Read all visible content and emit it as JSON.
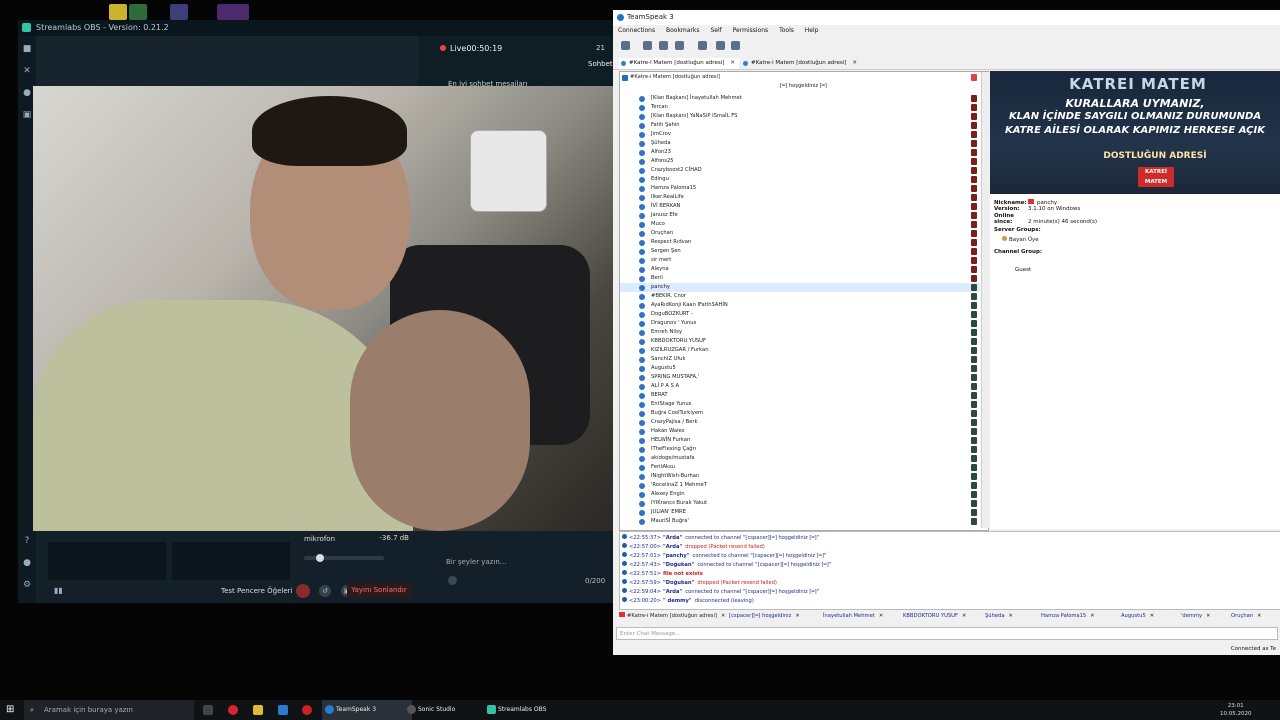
{
  "obs": {
    "window_title": "Streamlabs OBS - Version: 0.21.2",
    "live_label": "Live00:50:19",
    "viewer_count": "21",
    "side_tab": "Sohbet",
    "chat_hint": "En iyi sohbet mesajları",
    "mic_label": "mikrofon",
    "mic_db": "-36.7 dB",
    "chat_placeholder": "Bir şeyler yazın...",
    "chat_count": "0/200",
    "scene_name": "Test Pencere Öğeleri",
    "end_stream": "Yayını Sonlandır"
  },
  "ts": {
    "window_title": "TeamSpeak 3",
    "menu": [
      "Connections",
      "Bookmarks",
      "Self",
      "Permissions",
      "Tools",
      "Help"
    ],
    "tabs": [
      "#Katre-i Matem [dostluğun adresi]",
      "#Katre-i Matem [dostluğun adresi]"
    ],
    "server_row": "#Katre-i Matem [dostluğun adresi]",
    "channel_row": "[═] hoşgeldiniz [═]",
    "users": [
      "[Klan Başkanı] İnayetullah Mehmet",
      "Tercan",
      "[Klan Başkanı] YaNaSiP ISmaİL FS",
      "Fatih Şahin",
      "JimCrov",
      "Şüheda",
      "Alfon23",
      "Alfons25",
      "Crazyboost2 CİHAD",
      "Edingu",
      "Hamza Paloma15",
      "Ilker.RealLife",
      "İVİ BERKAN",
      "Janusz Efe",
      "Muco",
      "Oruçhan",
      "Respect Rıdvan",
      "Sergen Şen",
      "sir mert",
      "Aleyna",
      "Beril",
      "panchy",
      "#BEKIR. Cnor",
      "AyaRıdKonji Kaan IFatihSAHİN",
      "DoguBOZKURT -",
      "Dragunov ' Yunus",
      "Emreh Nilsy",
      "KBBDOKTORU YUSUF",
      "KIZILRUZGAR / Furkan",
      "SanchiZ Ufuk",
      "Augustu5",
      "SPRING MUSTAFA,'",
      "ALİ P A S A",
      "BERAT",
      "EntStage Yunus",
      "Buğra CoolTurkiyem",
      "CrazyPajlsa / Berk",
      "Hakan Wales",
      "HELWİN Furkan",
      "ITheFlexing Çağrı",
      "akidoge/mustafa",
      "FeritAksu",
      "INightWish-Burhan",
      "'RocelinaZ 1 MehmeT",
      "Alexey Engin",
      "IYIKrancs Burak Yakut",
      "JULIAN' EMRE",
      "MauriSİ Buğra'"
    ],
    "selected_user": "panchy",
    "banner": {
      "line1": "KATREI MATEM",
      "line2": "KURALLARA UYMANIZ,",
      "line3": "KLAN İÇİNDE SAYGILI OLMANIZ DURUMUNDA",
      "line4": "KATRE AİLESİ OLARAK KAPIMIZ HERKESE AÇIK",
      "line5": "DOSTLUĞUN ADRESİ",
      "badge": "KATREİ MATEM"
    },
    "client": {
      "nickname_label": "Nickname:",
      "nickname": "panchy",
      "version_label": "Version:",
      "version": "3.1.10 on Windows",
      "online_label": "Online since:",
      "online": "2 minute(s) 46 second(s)",
      "server_groups_label": "Server Groups:",
      "server_group": "Bayan Üye",
      "channel_group_label": "Channel Group:",
      "channel_group": "Guest"
    },
    "log": [
      {
        "time": "<22:55:37>",
        "name": "\"Arda\"",
        "msg": "connected to channel \"[cspacer][═] hoşgeldiniz [═]\"",
        "red": false
      },
      {
        "time": "<22:57:00>",
        "name": "\"Arda\"",
        "msg": "dropped (Packet resend failed)",
        "red": true
      },
      {
        "time": "<22:57:01>",
        "name": "\"panchy\"",
        "msg": "connected to channel \"[cspacer][═] hoşgeldiniz [═]\"",
        "red": false
      },
      {
        "time": "<22:57:43>",
        "name": "\"Doğukan\"",
        "msg": "connected to channel \"[cspacer][═] hoşgeldiniz [═]\"",
        "red": false
      },
      {
        "time": "<22:57:51>",
        "name": "file not exists",
        "msg": "",
        "red": true
      },
      {
        "time": "<22:57:59>",
        "name": "\"Doğukan\"",
        "msg": "dropped (Packet resend failed)",
        "red": true
      },
      {
        "time": "<22:59:04>",
        "name": "\"Arda\"",
        "msg": "connected to channel \"[cspacer][═] hoşgeldiniz [═]\"",
        "red": false
      },
      {
        "time": "<23:00:20>",
        "name": "\" demmy\"",
        "msg": "disconnected (leaving)",
        "red": false
      }
    ],
    "bottom_tabs": [
      "#Katre-i Matem [dostluğun adresi]",
      "[cspacer][═] hoşgeldiniz",
      "İnayetullah Mehmet",
      "KBBDOKTORU YUSUF",
      "Şüheda",
      "Hamza Paloma15",
      "Augustu5",
      "'demmy",
      "Oruçhan"
    ],
    "chat_placeholder": "Enter Chat Message...",
    "status": "Connected as Te"
  },
  "taskbar": {
    "search": "Aramak için buraya yazın",
    "apps": [
      "TeamSpeak 3",
      "Sonic Studio",
      "Streamlabs OBS"
    ],
    "time": "23:01",
    "date": "10.05.2020"
  }
}
